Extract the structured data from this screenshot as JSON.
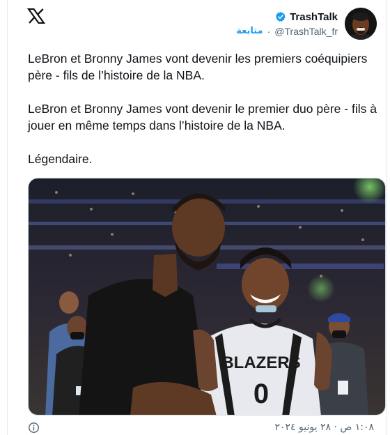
{
  "author": {
    "display_name": "TrashTalk",
    "handle": "@TrashTalk_fr",
    "follow_label": "متابعة",
    "separator": "·"
  },
  "tweet": {
    "paragraphs": [
      "LeBron et Bronny James vont devenir les premiers coéquipiers père - fils de l’histoire de la NBA.",
      "LeBron et Bronny James vont devenir le premier duo père - fils à jouer en même temps dans l’histoire de la NBA.",
      "Légendaire."
    ]
  },
  "media": {
    "jersey_text": "BLAZERS",
    "jersey_number": "0"
  },
  "footer": {
    "timestamp": "١:٠٨ ص · ٢٨ يونيو ٢٠٢٤"
  },
  "colors": {
    "accent": "#1d9bf0",
    "text": "#0f1419",
    "muted": "#536471"
  },
  "icons": [
    "x-logo-icon",
    "verified-badge-icon",
    "info-icon"
  ]
}
